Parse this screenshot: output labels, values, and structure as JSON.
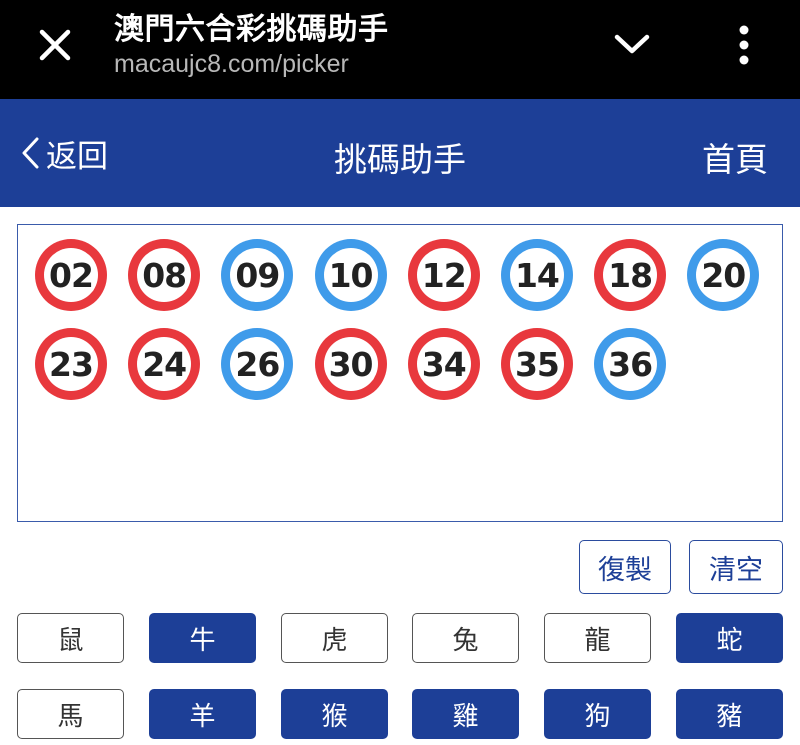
{
  "browser": {
    "title": "澳門六合彩挑碼助手",
    "url": "macaujc8.com/picker"
  },
  "header": {
    "back_label": "返回",
    "title": "挑碼助手",
    "home_label": "首頁",
    "background_color": "#1d3f97"
  },
  "picked_numbers": [
    {
      "number": "02",
      "color": "red"
    },
    {
      "number": "08",
      "color": "red"
    },
    {
      "number": "09",
      "color": "blue"
    },
    {
      "number": "10",
      "color": "blue"
    },
    {
      "number": "12",
      "color": "red"
    },
    {
      "number": "14",
      "color": "blue"
    },
    {
      "number": "18",
      "color": "red"
    },
    {
      "number": "20",
      "color": "blue"
    },
    {
      "number": "23",
      "color": "red"
    },
    {
      "number": "24",
      "color": "red"
    },
    {
      "number": "26",
      "color": "blue"
    },
    {
      "number": "30",
      "color": "red"
    },
    {
      "number": "34",
      "color": "red"
    },
    {
      "number": "35",
      "color": "red"
    },
    {
      "number": "36",
      "color": "blue"
    }
  ],
  "ball_colors": {
    "red": "#e8383d",
    "blue": "#3f9bea"
  },
  "actions": {
    "copy_label": "復製",
    "clear_label": "清空"
  },
  "zodiac": [
    {
      "label": "鼠",
      "selected": false
    },
    {
      "label": "牛",
      "selected": true
    },
    {
      "label": "虎",
      "selected": false
    },
    {
      "label": "兔",
      "selected": false
    },
    {
      "label": "龍",
      "selected": false
    },
    {
      "label": "蛇",
      "selected": true
    },
    {
      "label": "馬",
      "selected": false
    },
    {
      "label": "羊",
      "selected": true
    },
    {
      "label": "猴",
      "selected": true
    },
    {
      "label": "雞",
      "selected": true
    },
    {
      "label": "狗",
      "selected": true
    },
    {
      "label": "豬",
      "selected": true
    }
  ]
}
